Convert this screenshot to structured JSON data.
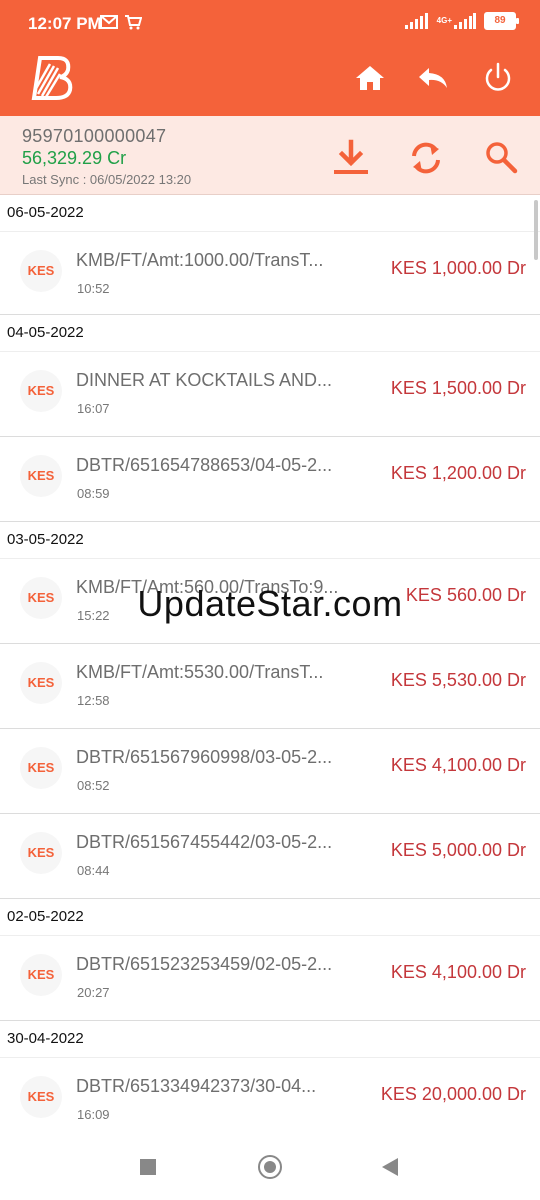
{
  "status_bar": {
    "time": "12:07 PM",
    "network": "4G+",
    "battery": "89"
  },
  "account": {
    "number": "95970100000047",
    "balance": "56,329.29 Cr",
    "last_sync": "Last Sync : 06/05/2022 13:20"
  },
  "groups": [
    {
      "date": "06-05-2022",
      "items": [
        {
          "badge": "KES",
          "desc": "KMB/FT/Amt:1000.00/TransT...",
          "time": "10:52",
          "amount": "KES 1,000.00 Dr"
        }
      ]
    },
    {
      "date": "04-05-2022",
      "items": [
        {
          "badge": "KES",
          "desc": "DINNER AT KOCKTAILS AND...",
          "time": "16:07",
          "amount": "KES 1,500.00 Dr"
        },
        {
          "badge": "KES",
          "desc": "DBTR/651654788653/04-05-2...",
          "time": "08:59",
          "amount": "KES 1,200.00 Dr"
        }
      ]
    },
    {
      "date": "03-05-2022",
      "items": [
        {
          "badge": "KES",
          "desc": "KMB/FT/Amt:560.00/TransTo:9...",
          "time": "15:22",
          "amount": "KES 560.00 Dr"
        },
        {
          "badge": "KES",
          "desc": "KMB/FT/Amt:5530.00/TransT...",
          "time": "12:58",
          "amount": "KES 5,530.00 Dr"
        },
        {
          "badge": "KES",
          "desc": "DBTR/651567960998/03-05-2...",
          "time": "08:52",
          "amount": "KES 4,100.00 Dr"
        },
        {
          "badge": "KES",
          "desc": "DBTR/651567455442/03-05-2...",
          "time": "08:44",
          "amount": "KES 5,000.00 Dr"
        }
      ]
    },
    {
      "date": "02-05-2022",
      "items": [
        {
          "badge": "KES",
          "desc": "DBTR/651523253459/02-05-2...",
          "time": "20:27",
          "amount": "KES 4,100.00 Dr"
        }
      ]
    },
    {
      "date": "30-04-2022",
      "items": [
        {
          "badge": "KES",
          "desc": "DBTR/651334942373/30-04...",
          "time": "16:09",
          "amount": "KES 20,000.00 Dr"
        }
      ]
    }
  ],
  "watermark": "UpdateStar.com",
  "colors": {
    "brand": "#f4623a",
    "header_bg": "#fde9e3",
    "credit": "#21a048",
    "debit": "#c4373b"
  },
  "icons": {
    "app_bar": [
      "bank-logo-icon",
      "home-icon",
      "back-icon",
      "power-icon"
    ],
    "account_bar": [
      "download-icon",
      "refresh-icon",
      "search-icon"
    ]
  }
}
